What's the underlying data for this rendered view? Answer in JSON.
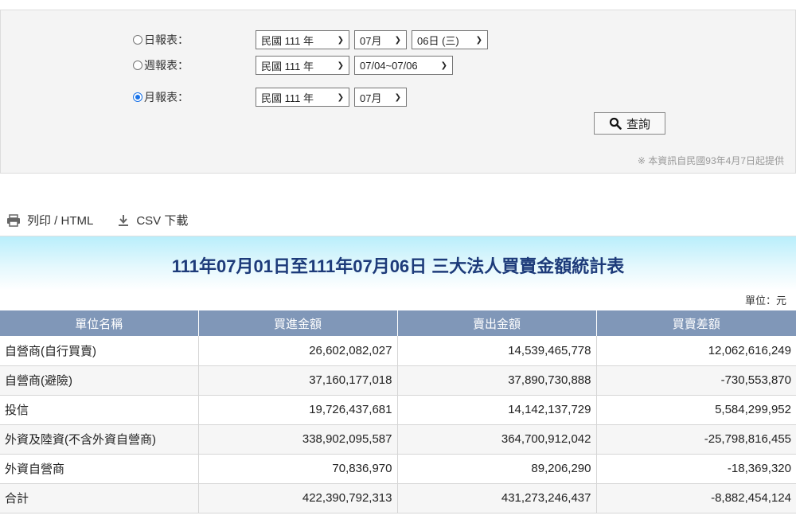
{
  "query": {
    "daily": {
      "label": "日報表：",
      "year": "民國 111 年",
      "month": "07月",
      "day": "06日 (三)",
      "checked": false
    },
    "weekly": {
      "label": "週報表：",
      "year": "民國 111 年",
      "week": "07/04~07/06",
      "checked": false
    },
    "monthly": {
      "label": "月報表：",
      "year": "民國 111 年",
      "month": "07月",
      "checked": true
    },
    "search_label": "查詢",
    "note": "※ 本資訊自民國93年4月7日起提供"
  },
  "toolbar": {
    "print_label": "列印 / HTML",
    "csv_label": "CSV 下載"
  },
  "report": {
    "title": "111年07月01日至111年07月06日 三大法人買賣金額統計表",
    "unit": "單位：元",
    "headers": [
      "單位名稱",
      "買進金額",
      "賣出金額",
      "買賣差額"
    ],
    "rows": [
      [
        "自營商(自行買賣)",
        "26,602,082,027",
        "14,539,465,778",
        "12,062,616,249"
      ],
      [
        "自營商(避險)",
        "37,160,177,018",
        "37,890,730,888",
        "-730,553,870"
      ],
      [
        "投信",
        "19,726,437,681",
        "14,142,137,729",
        "5,584,299,952"
      ],
      [
        "外資及陸資(不含外資自營商)",
        "338,902,095,587",
        "364,700,912,042",
        "-25,798,816,455"
      ],
      [
        "外資自營商",
        "70,836,970",
        "89,206,290",
        "-18,369,320"
      ],
      [
        "合計",
        "422,390,792,313",
        "431,273,246,437",
        "-8,882,454,124"
      ]
    ]
  },
  "colors": {
    "header_bg": "#8097b8",
    "title_color": "#1d3b7a",
    "radio_checked": "#1a73e8"
  }
}
